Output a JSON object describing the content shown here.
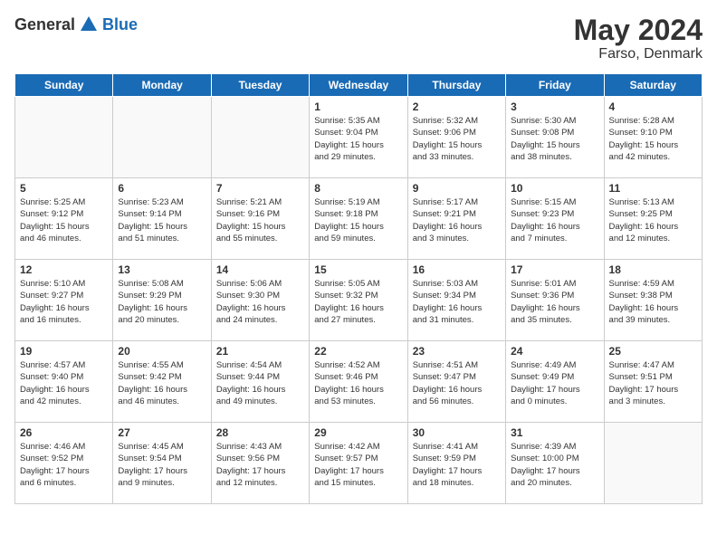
{
  "header": {
    "logo_general": "General",
    "logo_blue": "Blue",
    "month_year": "May 2024",
    "location": "Farso, Denmark"
  },
  "days_of_week": [
    "Sunday",
    "Monday",
    "Tuesday",
    "Wednesday",
    "Thursday",
    "Friday",
    "Saturday"
  ],
  "weeks": [
    [
      {
        "day": "",
        "content": ""
      },
      {
        "day": "",
        "content": ""
      },
      {
        "day": "",
        "content": ""
      },
      {
        "day": "1",
        "content": "Sunrise: 5:35 AM\nSunset: 9:04 PM\nDaylight: 15 hours\nand 29 minutes."
      },
      {
        "day": "2",
        "content": "Sunrise: 5:32 AM\nSunset: 9:06 PM\nDaylight: 15 hours\nand 33 minutes."
      },
      {
        "day": "3",
        "content": "Sunrise: 5:30 AM\nSunset: 9:08 PM\nDaylight: 15 hours\nand 38 minutes."
      },
      {
        "day": "4",
        "content": "Sunrise: 5:28 AM\nSunset: 9:10 PM\nDaylight: 15 hours\nand 42 minutes."
      }
    ],
    [
      {
        "day": "5",
        "content": "Sunrise: 5:25 AM\nSunset: 9:12 PM\nDaylight: 15 hours\nand 46 minutes."
      },
      {
        "day": "6",
        "content": "Sunrise: 5:23 AM\nSunset: 9:14 PM\nDaylight: 15 hours\nand 51 minutes."
      },
      {
        "day": "7",
        "content": "Sunrise: 5:21 AM\nSunset: 9:16 PM\nDaylight: 15 hours\nand 55 minutes."
      },
      {
        "day": "8",
        "content": "Sunrise: 5:19 AM\nSunset: 9:18 PM\nDaylight: 15 hours\nand 59 minutes."
      },
      {
        "day": "9",
        "content": "Sunrise: 5:17 AM\nSunset: 9:21 PM\nDaylight: 16 hours\nand 3 minutes."
      },
      {
        "day": "10",
        "content": "Sunrise: 5:15 AM\nSunset: 9:23 PM\nDaylight: 16 hours\nand 7 minutes."
      },
      {
        "day": "11",
        "content": "Sunrise: 5:13 AM\nSunset: 9:25 PM\nDaylight: 16 hours\nand 12 minutes."
      }
    ],
    [
      {
        "day": "12",
        "content": "Sunrise: 5:10 AM\nSunset: 9:27 PM\nDaylight: 16 hours\nand 16 minutes."
      },
      {
        "day": "13",
        "content": "Sunrise: 5:08 AM\nSunset: 9:29 PM\nDaylight: 16 hours\nand 20 minutes."
      },
      {
        "day": "14",
        "content": "Sunrise: 5:06 AM\nSunset: 9:30 PM\nDaylight: 16 hours\nand 24 minutes."
      },
      {
        "day": "15",
        "content": "Sunrise: 5:05 AM\nSunset: 9:32 PM\nDaylight: 16 hours\nand 27 minutes."
      },
      {
        "day": "16",
        "content": "Sunrise: 5:03 AM\nSunset: 9:34 PM\nDaylight: 16 hours\nand 31 minutes."
      },
      {
        "day": "17",
        "content": "Sunrise: 5:01 AM\nSunset: 9:36 PM\nDaylight: 16 hours\nand 35 minutes."
      },
      {
        "day": "18",
        "content": "Sunrise: 4:59 AM\nSunset: 9:38 PM\nDaylight: 16 hours\nand 39 minutes."
      }
    ],
    [
      {
        "day": "19",
        "content": "Sunrise: 4:57 AM\nSunset: 9:40 PM\nDaylight: 16 hours\nand 42 minutes."
      },
      {
        "day": "20",
        "content": "Sunrise: 4:55 AM\nSunset: 9:42 PM\nDaylight: 16 hours\nand 46 minutes."
      },
      {
        "day": "21",
        "content": "Sunrise: 4:54 AM\nSunset: 9:44 PM\nDaylight: 16 hours\nand 49 minutes."
      },
      {
        "day": "22",
        "content": "Sunrise: 4:52 AM\nSunset: 9:46 PM\nDaylight: 16 hours\nand 53 minutes."
      },
      {
        "day": "23",
        "content": "Sunrise: 4:51 AM\nSunset: 9:47 PM\nDaylight: 16 hours\nand 56 minutes."
      },
      {
        "day": "24",
        "content": "Sunrise: 4:49 AM\nSunset: 9:49 PM\nDaylight: 17 hours\nand 0 minutes."
      },
      {
        "day": "25",
        "content": "Sunrise: 4:47 AM\nSunset: 9:51 PM\nDaylight: 17 hours\nand 3 minutes."
      }
    ],
    [
      {
        "day": "26",
        "content": "Sunrise: 4:46 AM\nSunset: 9:52 PM\nDaylight: 17 hours\nand 6 minutes."
      },
      {
        "day": "27",
        "content": "Sunrise: 4:45 AM\nSunset: 9:54 PM\nDaylight: 17 hours\nand 9 minutes."
      },
      {
        "day": "28",
        "content": "Sunrise: 4:43 AM\nSunset: 9:56 PM\nDaylight: 17 hours\nand 12 minutes."
      },
      {
        "day": "29",
        "content": "Sunrise: 4:42 AM\nSunset: 9:57 PM\nDaylight: 17 hours\nand 15 minutes."
      },
      {
        "day": "30",
        "content": "Sunrise: 4:41 AM\nSunset: 9:59 PM\nDaylight: 17 hours\nand 18 minutes."
      },
      {
        "day": "31",
        "content": "Sunrise: 4:39 AM\nSunset: 10:00 PM\nDaylight: 17 hours\nand 20 minutes."
      },
      {
        "day": "",
        "content": ""
      }
    ]
  ]
}
